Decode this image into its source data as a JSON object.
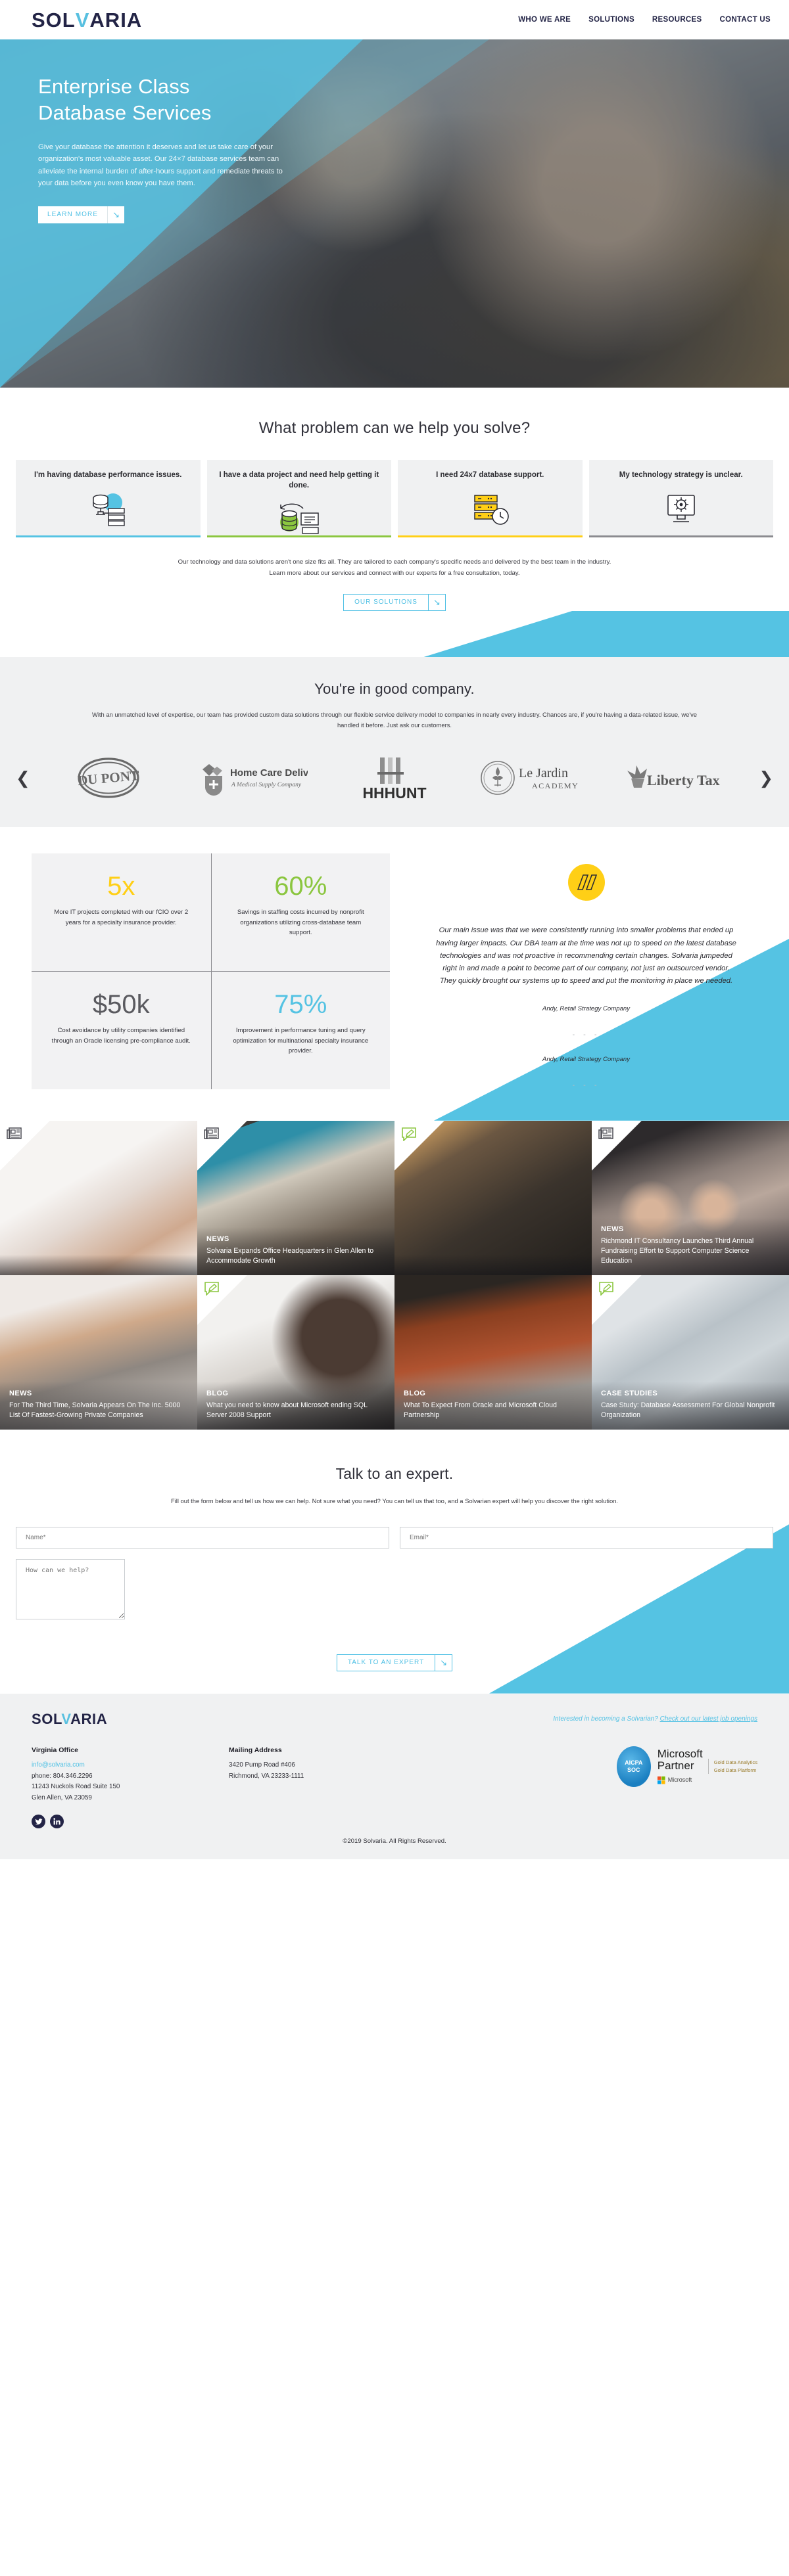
{
  "colors": {
    "brand_blue": "#55c3e3",
    "navy": "#232446",
    "green": "#8bc63f",
    "yellow": "#ffcf16",
    "gray": "#5a5a5f"
  },
  "header": {
    "logo_main": "SOL",
    "logo_v": "V",
    "logo_rest": "ARIA",
    "nav": [
      {
        "label": "WHO WE ARE"
      },
      {
        "label": "SOLUTIONS"
      },
      {
        "label": "RESOURCES"
      },
      {
        "label": "CONTACT US"
      }
    ]
  },
  "hero": {
    "title_line1": "Enterprise Class",
    "title_line2": "Database Services",
    "body": "Give your database the attention it deserves and let us take care of your organization's most valuable asset. Our 24×7 database services team can alleviate the internal burden of after-hours support and remediate threats to your data before you even know you have them.",
    "cta": "LEARN MORE",
    "cta_icon": "arrow-down-right-icon"
  },
  "problem": {
    "heading": "What problem can we help you solve?",
    "cards": [
      {
        "title": "I'm having database performance issues.",
        "icon": "database-server-icon",
        "accent": "#55c3e3"
      },
      {
        "title": "I have a data project and need help getting it done.",
        "icon": "database-sync-icon",
        "accent": "#8bc63f"
      },
      {
        "title": "I need 24x7 database support.",
        "icon": "database-clock-icon",
        "accent": "#ffcf16"
      },
      {
        "title": "My technology strategy is unclear.",
        "icon": "strategy-gears-icon",
        "accent": "#8b8b90"
      }
    ],
    "intro_line1": "Our technology and data solutions aren't one size fits all. They are tailored to each company's specific needs and delivered by the best team in the industry.",
    "intro_line2": "Learn more about our services and connect with our experts for a free consultation, today.",
    "cta": "OUR SOLUTIONS",
    "cta_icon": "arrow-down-right-icon"
  },
  "good_company": {
    "heading": "You're in good company.",
    "body": "With an unmatched level of expertise, our team has provided custom data solutions through our flexible service delivery model to companies in nearly every industry. Chances are, if you're having a data-related issue, we've handled it before. Just ask our customers.",
    "prev_icon": "chevron-left-icon",
    "next_icon": "chevron-right-icon",
    "logos": [
      {
        "name": "DU PONT"
      },
      {
        "name": "Home Care Delivered",
        "tagline": "A Medical Supply Company"
      },
      {
        "name": "HHHUNT"
      },
      {
        "name": "Le Jardin",
        "tagline": "ACADEMY"
      },
      {
        "name": "Liberty Tax"
      }
    ]
  },
  "stats": [
    {
      "value": "5x",
      "color": "#ffcf16",
      "text": "More IT projects completed with our fCIO over 2 years for a specialty insurance provider."
    },
    {
      "value": "60%",
      "color": "#8bc63f",
      "text": "Savings in staffing costs incurred by nonprofit organizations utilizing cross-database team support."
    },
    {
      "value": "$50k",
      "color": "#5a5a5f",
      "text": "Cost avoidance by utility companies identified through an Oracle licensing pre-compliance audit."
    },
    {
      "value": "75%",
      "color": "#55c3e3",
      "text": "Improvement in performance tuning and query optimization for multinational specialty insurance provider."
    }
  ],
  "testimonial": {
    "mark_icon": "quote-mark-icon",
    "quote": "Our main issue was that we were consistently running into smaller problems that ended up having larger impacts. Our DBA team at the time was not up to speed on the latest database technologies and was not proactive in recommending certain changes. Solvaria jumpeded right in and made a point to become part of our company, not just an outsourced vendor. They quickly brought our systems up to speed and put the monitoring in place we needed.",
    "author": "Andy, Retail Strategy Company",
    "author_secondary": "Andy, Retail Strategy Company",
    "dots": "- - -"
  },
  "posts": [
    {
      "kicker": "",
      "title": "",
      "icon": "newspaper-icon",
      "icon_color": "#4a4a52",
      "img": "hand-laptop"
    },
    {
      "kicker": "NEWS",
      "title": "Solvaria Expands Office Headquarters in Glen Allen to Accommodate Growth",
      "icon": "newspaper-icon",
      "icon_color": "#4a4a52",
      "img": "office-hall"
    },
    {
      "kicker": "",
      "title": "",
      "icon": "pencil-comment-icon",
      "icon_color": "#8bc63f",
      "img": "dark-monitor"
    },
    {
      "kicker": "NEWS",
      "title": "Richmond IT Consultancy Launches Third Annual Fundraising Effort to Support Computer Science Education",
      "icon": "newspaper-icon",
      "icon_color": "#4a4a52",
      "img": "crowd-cheering"
    },
    {
      "kicker": "NEWS",
      "title": "For The Third Time, Solvaria Appears On The Inc. 5000 List Of Fastest-Growing Private Companies",
      "icon": "",
      "icon_color": "#4a4a52",
      "img": "typing-laptop"
    },
    {
      "kicker": "BLOG",
      "title": "What you need to know about Microsoft ending SQL Server 2008 Support",
      "icon": "pencil-comment-icon",
      "icon_color": "#8bc63f",
      "img": "woman-glasses"
    },
    {
      "kicker": "BLOG",
      "title": "What To Expect From Oracle and Microsoft Cloud Partnership",
      "icon": "",
      "icon_color": "#8bc63f",
      "img": "warm-desk"
    },
    {
      "kicker": "CASE STUDIES",
      "title": "Case Study: Database Assessment For Global Nonprofit Organization",
      "icon": "pencil-comment-icon",
      "icon_color": "#8bc63f",
      "img": "city-tablet"
    }
  ],
  "contact": {
    "heading": "Talk to an expert.",
    "lead": "Fill out the form below and tell us how we can help. Not sure what you need? You can tell us that too, and a Solvarian expert will help you discover the right solution.",
    "name_placeholder": "Name*",
    "email_placeholder": "Email*",
    "message_placeholder": "How can we help?",
    "submit": "TALK TO AN EXPERT",
    "submit_icon": "arrow-down-right-icon"
  },
  "footer": {
    "logo_main": "SOL",
    "logo_v": "V",
    "logo_rest": "ARIA",
    "jobs_text": "Interested in becoming a Solvarian? ",
    "jobs_link": "Check out our latest job openings",
    "office_heading": "Virginia Office",
    "email": "info@solvaria.com",
    "phone": "phone: 804.346.2296",
    "address1": "11243 Nuckols Road Suite 150",
    "address2": "Glen Allen, VA 23059",
    "mailing_heading": "Mailing Address",
    "mailing1": "3420 Pump Road #406",
    "mailing2": "Richmond, VA 23233-1111",
    "social": [
      {
        "name": "twitter-icon",
        "glyph": "✉"
      },
      {
        "name": "linkedin-icon",
        "glyph": "in"
      }
    ],
    "badge_aicpa_line1": "AICPA",
    "badge_aicpa_line2": "SOC",
    "badge_ms_line1": "Microsoft",
    "badge_ms_line2": "Partner",
    "badge_gold1": "Gold Data Analytics",
    "badge_gold2": "Gold Data Platform",
    "badge_ms_small": "Microsoft",
    "copyright": "©2019 Solvaria. All Rights Reserved."
  }
}
